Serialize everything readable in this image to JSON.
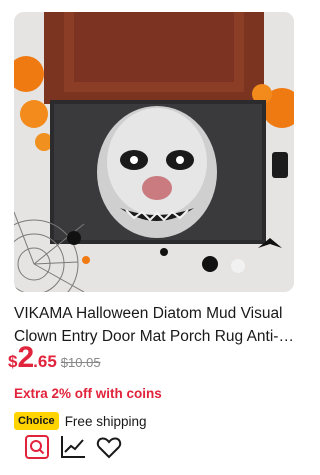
{
  "product": {
    "image_alt": "Halloween clown door mat product photo",
    "title": "VIKAMA Halloween Diatom Mud Visual Clown Entry Door Mat Porch Rug Anti-Slip",
    "price": {
      "currency": "$",
      "integer": "2",
      "decimal": ".65",
      "original": "$10.05"
    },
    "promo": "Extra 2% off with coins",
    "choice_badge": "Choice",
    "shipping": "Free shipping"
  },
  "colors": {
    "price": "#e1233c",
    "promo": "#e1233c",
    "choice_badge_bg": "#ffd400",
    "original_price": "#888888"
  },
  "icons": {
    "image_search": "image-search-icon",
    "price_trend": "price-trend-icon",
    "wishlist": "heart-icon"
  }
}
